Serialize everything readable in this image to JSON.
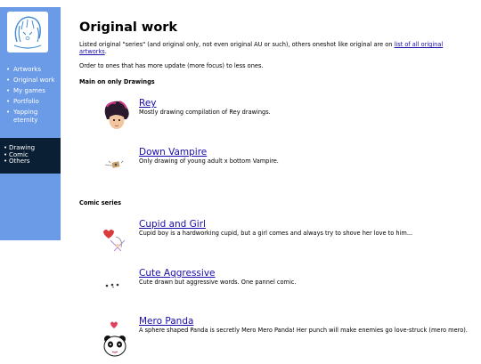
{
  "sidebar": {
    "nav_primary": [
      {
        "label": "Artworks"
      },
      {
        "label": "Original work"
      },
      {
        "label": "My games"
      },
      {
        "label": "Portfolio"
      },
      {
        "label": "Yapping eternity"
      }
    ],
    "nav_secondary": [
      {
        "label": "Drawing"
      },
      {
        "label": "Comic"
      },
      {
        "label": "Others"
      }
    ]
  },
  "main": {
    "title": "Original work",
    "intro_text": "Listed original \"series\" (and original only, not even original AU or such), others oneshot like original are on ",
    "intro_link": "list of all original artworks",
    "intro_end": ".",
    "order_note": "Order to ones that has more update (more focus) to less ones.",
    "sections": [
      {
        "heading": "Main on only Drawings",
        "entries": [
          {
            "title": "Rey",
            "description": "Mostly drawing compilation of Rey drawings.",
            "icon": "rey-icon"
          },
          {
            "title": "Down Vampire",
            "description": "Only drawing of young adult x bottom Vampire.",
            "icon": "vampire-icon"
          }
        ]
      },
      {
        "heading": "Comic series",
        "entries": [
          {
            "title": "Cupid and Girl",
            "description": "Cupid boy is a hardworking cupid, but a girl comes and always try to shove her love to him...",
            "icon": "cupid-icon"
          },
          {
            "title": "Cute Aggressive",
            "description": "Cute drawn but aggressive words. One pannel comic.",
            "icon": "cute-face-icon"
          },
          {
            "title": "Mero Panda",
            "description": "A sphere shaped Panda is secretly Mero Mero Panda! Her punch will make enemies go love-struck (mero mero).",
            "icon": "panda-icon"
          }
        ]
      }
    ]
  },
  "colors": {
    "sidebar_bg": "#6b9be6",
    "sidebar_dark": "#0a1f33",
    "link": "#1a0dab"
  }
}
